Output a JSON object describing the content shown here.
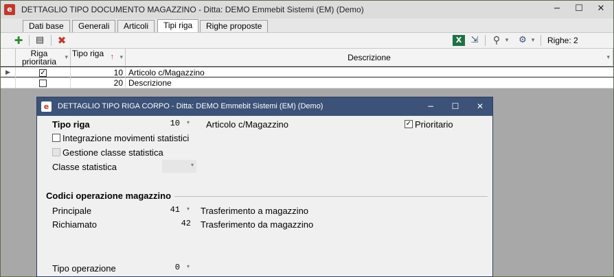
{
  "main_window": {
    "title": "DETTAGLIO TIPO DOCUMENTO MAGAZZINO - Ditta: DEMO Emmebit Sistemi (EM)  (Demo)",
    "logo_letter": "e",
    "min": "−",
    "max": "☐",
    "close": "✕"
  },
  "tabs": [
    {
      "label": "Dati base"
    },
    {
      "label": "Generali"
    },
    {
      "label": "Articoli"
    },
    {
      "label": "Tipi riga"
    },
    {
      "label": "Righe proposte"
    }
  ],
  "toolbar": {
    "add_icon": "✚",
    "edit_icon": "▤",
    "delete_icon": "✖",
    "excel_icon": "X",
    "export_icon": "⇲",
    "search_icon": "⚲",
    "dropdown": "▾",
    "filter_icon": "⚙",
    "count_label": "Righe: 2"
  },
  "grid": {
    "headers": {
      "priority": "Riga prioritaria",
      "type": "Tipo riga",
      "sort_icon": "↑",
      "description": "Descrizione",
      "filter_arrow": "▾"
    },
    "rows": [
      {
        "priority": true,
        "type": "10",
        "description": "Articolo c/Magazzino",
        "pointer": "▶"
      },
      {
        "priority": false,
        "type": "20",
        "description": "Descrizione",
        "pointer": ""
      }
    ]
  },
  "dialog": {
    "title": "DETTAGLIO TIPO RIGA CORPO - Ditta: DEMO Emmebit Sistemi (EM)  (Demo)",
    "logo_letter": "e",
    "min": "−",
    "max": "☐",
    "close": "✕",
    "tipo_riga_label": "Tipo riga",
    "tipo_riga_value": "10",
    "tipo_riga_desc": "Articolo c/Magazzino",
    "prioritario_label": "Prioritario",
    "prioritario_checked": true,
    "integrazione_label": "Integrazione movimenti statistici",
    "gestione_label": "Gestione classe statistica",
    "classe_label": "Classe statistica",
    "classe_value": "",
    "section_title": "Codici operazione magazzino",
    "principale_label": "Principale",
    "principale_value": "41",
    "principale_desc": "Trasferimento a magazzino",
    "richiamato_label": "Richiamato",
    "richiamato_value": "42",
    "richiamato_desc": "Trasferimento da magazzino",
    "tipo_op_label": "Tipo operazione",
    "tipo_op_value": "0",
    "combo_arrow": "▾"
  }
}
